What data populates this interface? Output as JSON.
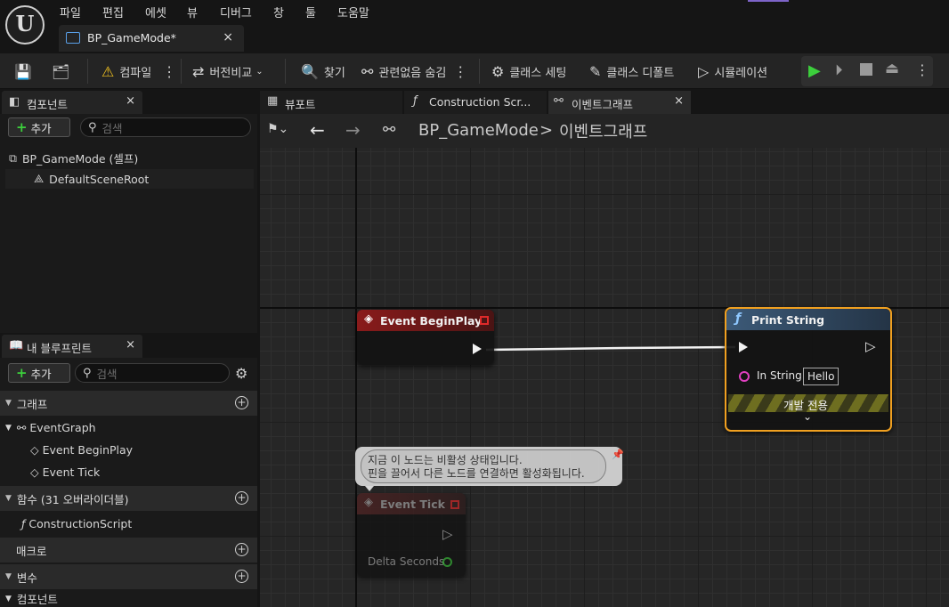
{
  "menu": {
    "logo": "U",
    "items": [
      "파일",
      "편집",
      "에셋",
      "뷰",
      "디버그",
      "창",
      "툴",
      "도움말"
    ]
  },
  "document_tab": {
    "title": "BP_GameMode*",
    "close": "×"
  },
  "toolbar": {
    "compile": "컴파일",
    "diff": "버전비교",
    "find": "찾기",
    "hide_unrelated": "관련없음 숨김",
    "class_settings": "클래스 세팅",
    "class_defaults": "클래스 디폴트",
    "simulation": "시뮬레이션"
  },
  "components_panel": {
    "tab_label": "컴포넌트",
    "close": "×",
    "add_label": "추가",
    "search_placeholder": "검색",
    "tree": [
      "BP_GameMode (셀프)",
      "DefaultSceneRoot"
    ]
  },
  "blueprint_panel": {
    "tab_label": "내 블루프린트",
    "close": "×",
    "add_label": "추가",
    "search_placeholder": "검색",
    "sections": {
      "graphs": "그래프",
      "event_graph": "EventGraph",
      "begin_play": "Event BeginPlay",
      "tick": "Event Tick",
      "functions": "함수 (31 오버라이더블)",
      "construction": "ConstructionScript",
      "macros": "매크로",
      "variables": "변수",
      "components": "컴포넌트"
    }
  },
  "graph_tabs": {
    "viewport": "뷰포트",
    "construction": "Construction Scr...",
    "event_graph": "이벤트그래프",
    "close": "×"
  },
  "breadcrumb": {
    "asset": "BP_GameMode",
    "separator": ">",
    "graph": "이벤트그래프"
  },
  "nodes": {
    "begin_play": {
      "title": "Event BeginPlay"
    },
    "print_string": {
      "title": "Print String",
      "in_string_label": "In String",
      "in_string_value": "Hello",
      "dev_only": "개발 전용"
    },
    "tick": {
      "title": "Event Tick",
      "delta_label": "Delta Seconds"
    },
    "comment": {
      "line1": "지금 이 노드는 비활성 상태입니다.",
      "line2": "핀을 끌어서 다른 노드를 연결하면 활성화됩니다."
    }
  },
  "colors": {
    "event_header": "#8a1b1b",
    "function_header": "#3c5a78",
    "selection": "#f0a020",
    "add_green": "#3ccf3c",
    "play_green": "#3ccf3c"
  }
}
